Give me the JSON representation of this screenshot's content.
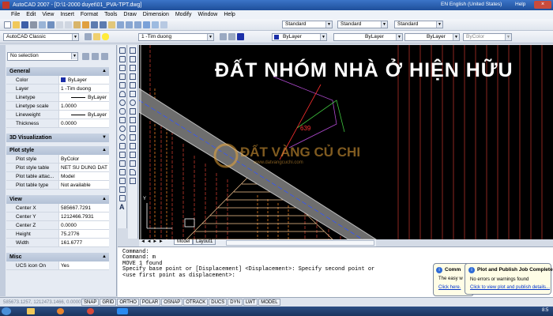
{
  "window": {
    "title": "AutoCAD 2007 - [D:\\1-2000 duyet\\01_PVA-TPT.dwg]",
    "language": "EN English (United States)",
    "help": "Help"
  },
  "menu": [
    "File",
    "Edit",
    "View",
    "Insert",
    "Format",
    "Tools",
    "Draw",
    "Dimension",
    "Modify",
    "Window",
    "Help"
  ],
  "toolbars": {
    "workspace": "AutoCAD Classic",
    "text_style": "Standard",
    "dim_style": "Standard",
    "table_style": "Standard",
    "layer": "1 -Tim duong",
    "color": "ByLayer",
    "linetype": "ByLayer",
    "lineweight": "ByLayer",
    "plotstyle": "ByColor"
  },
  "properties": {
    "selection": "No selection",
    "general": {
      "title": "General",
      "rows": [
        {
          "k": "Color",
          "v": "ByLayer"
        },
        {
          "k": "Layer",
          "v": "1 -Tim duong"
        },
        {
          "k": "Linetype",
          "v": "ByLayer"
        },
        {
          "k": "Linetype scale",
          "v": "1.0000"
        },
        {
          "k": "Lineweight",
          "v": "ByLayer"
        },
        {
          "k": "Thickness",
          "v": "0.0000"
        }
      ]
    },
    "viz": {
      "title": "3D Visualization"
    },
    "plot": {
      "title": "Plot style",
      "rows": [
        {
          "k": "Plot style",
          "v": "ByColor"
        },
        {
          "k": "Plot style table",
          "v": "NET SU DUNG DAT 1-2..."
        },
        {
          "k": "Plot table attac...",
          "v": "Model"
        },
        {
          "k": "Plot table type",
          "v": "Not available"
        }
      ]
    },
    "view": {
      "title": "View",
      "rows": [
        {
          "k": "Center X",
          "v": "585667.7291"
        },
        {
          "k": "Center Y",
          "v": "1212466.7931"
        },
        {
          "k": "Center Z",
          "v": "0.0000"
        },
        {
          "k": "Height",
          "v": "75.2776"
        },
        {
          "k": "Width",
          "v": "161.6777"
        }
      ]
    },
    "misc": {
      "title": "Misc",
      "rows": [
        {
          "k": "UCS icon On",
          "v": "Yes"
        }
      ]
    }
  },
  "canvas": {
    "banner": "ĐẤT NHÓM NHÀ Ở HIỆN HỮU",
    "label": "639",
    "watermark_main": "ĐẤT VÀNG CỦ CHI",
    "watermark_sub": "www.datvangcuchi.com"
  },
  "tabs": [
    "Model",
    "Layout1"
  ],
  "command": {
    "lines": [
      "Command:",
      "Command: m",
      "MOVE 1 found",
      "Specify base point or [Displacement] <Displacement>: Specify second point or",
      "<use first point as displacement>:"
    ]
  },
  "status": {
    "coords": "585673.1257, 1212473.1466, 0.0000",
    "toggles": [
      "SNAP",
      "GRID",
      "ORTHO",
      "POLAR",
      "OSNAP",
      "OTRACK",
      "DUCS",
      "DYN",
      "LWT",
      "MODEL"
    ]
  },
  "notifications": {
    "comm": {
      "title": "Comm",
      "text": "The easy w",
      "link": "Click here."
    },
    "plot": {
      "title": "Plot and Publish Job Complete",
      "text": "No errors or warnings found",
      "link": "Click to view plot and publish details..."
    }
  },
  "taskbar": {
    "time": "8:5"
  },
  "colors": {
    "canvas": "#000000",
    "road": "#6e6e6e",
    "brick": "#ffd9a0",
    "accent": "#ff2a2a"
  }
}
